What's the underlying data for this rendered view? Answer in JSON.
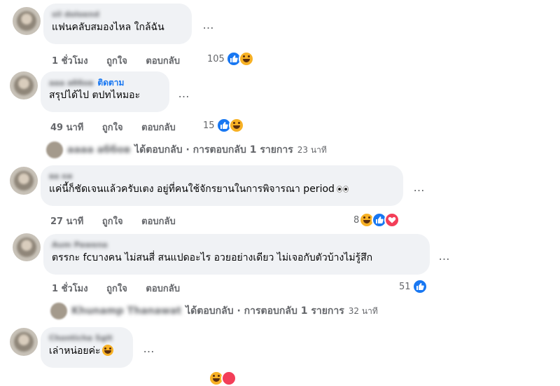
{
  "comments": [
    {
      "author": "sil doloend",
      "text": "แฟนคลับสมองไหล ใกล้ฉัน",
      "time": "1 ชั่วโมง",
      "like": "ถูกใจ",
      "reply": "ตอบกลับ",
      "reaction_count": "105"
    },
    {
      "author": "ааа аббов",
      "follow": "ติดตาม",
      "text": "สรุปได้ไป ตปทไหมอะ",
      "time": "49 นาที",
      "like": "ถูกใจ",
      "reply": "ตอบกลับ",
      "reaction_count": "15",
      "reply_summary": {
        "name": "аааа аббов",
        "replied": "ได้ตอบกลับ · การตอบกลับ 1 รายการ",
        "time": "23 นาที"
      }
    },
    {
      "author": "ва ки",
      "text": "แค่นี้ก็ชัดเจนแล้วครับเตง อยู่ที่คนใช้จักรยานในการพิจารณา period",
      "time": "27 นาที",
      "like": "ถูกใจ",
      "reply": "ตอบกลับ",
      "reaction_count": "8"
    },
    {
      "author": "Aum Pawena",
      "text": "ตรรกะ fcบางคน ไม่สนสี่ สนแปดอะไร อวยอย่างเดียว ไม่เจอกับตัวบ้างไม่รู้สึก",
      "time": "1 ชั่วโมง",
      "like": "ถูกใจ",
      "reply": "ตอบกลับ",
      "reaction_count": "51",
      "reply_summary": {
        "name": "Khunamp Thanawat",
        "replied": "ได้ตอบกลับ · การตอบกลับ 1 รายการ",
        "time": "32 นาที"
      }
    },
    {
      "author": "Chonticha Sgit",
      "text": "เล่าหน่อยค่ะ",
      "time": "",
      "like": "",
      "reply": "",
      "reaction_count": ""
    }
  ],
  "more_icon": "…",
  "colors": {
    "bubble": "#f0f2f5",
    "meta": "#65676b",
    "like": "#1877f2",
    "haha": "#f7b125",
    "love": "#f33e58"
  }
}
